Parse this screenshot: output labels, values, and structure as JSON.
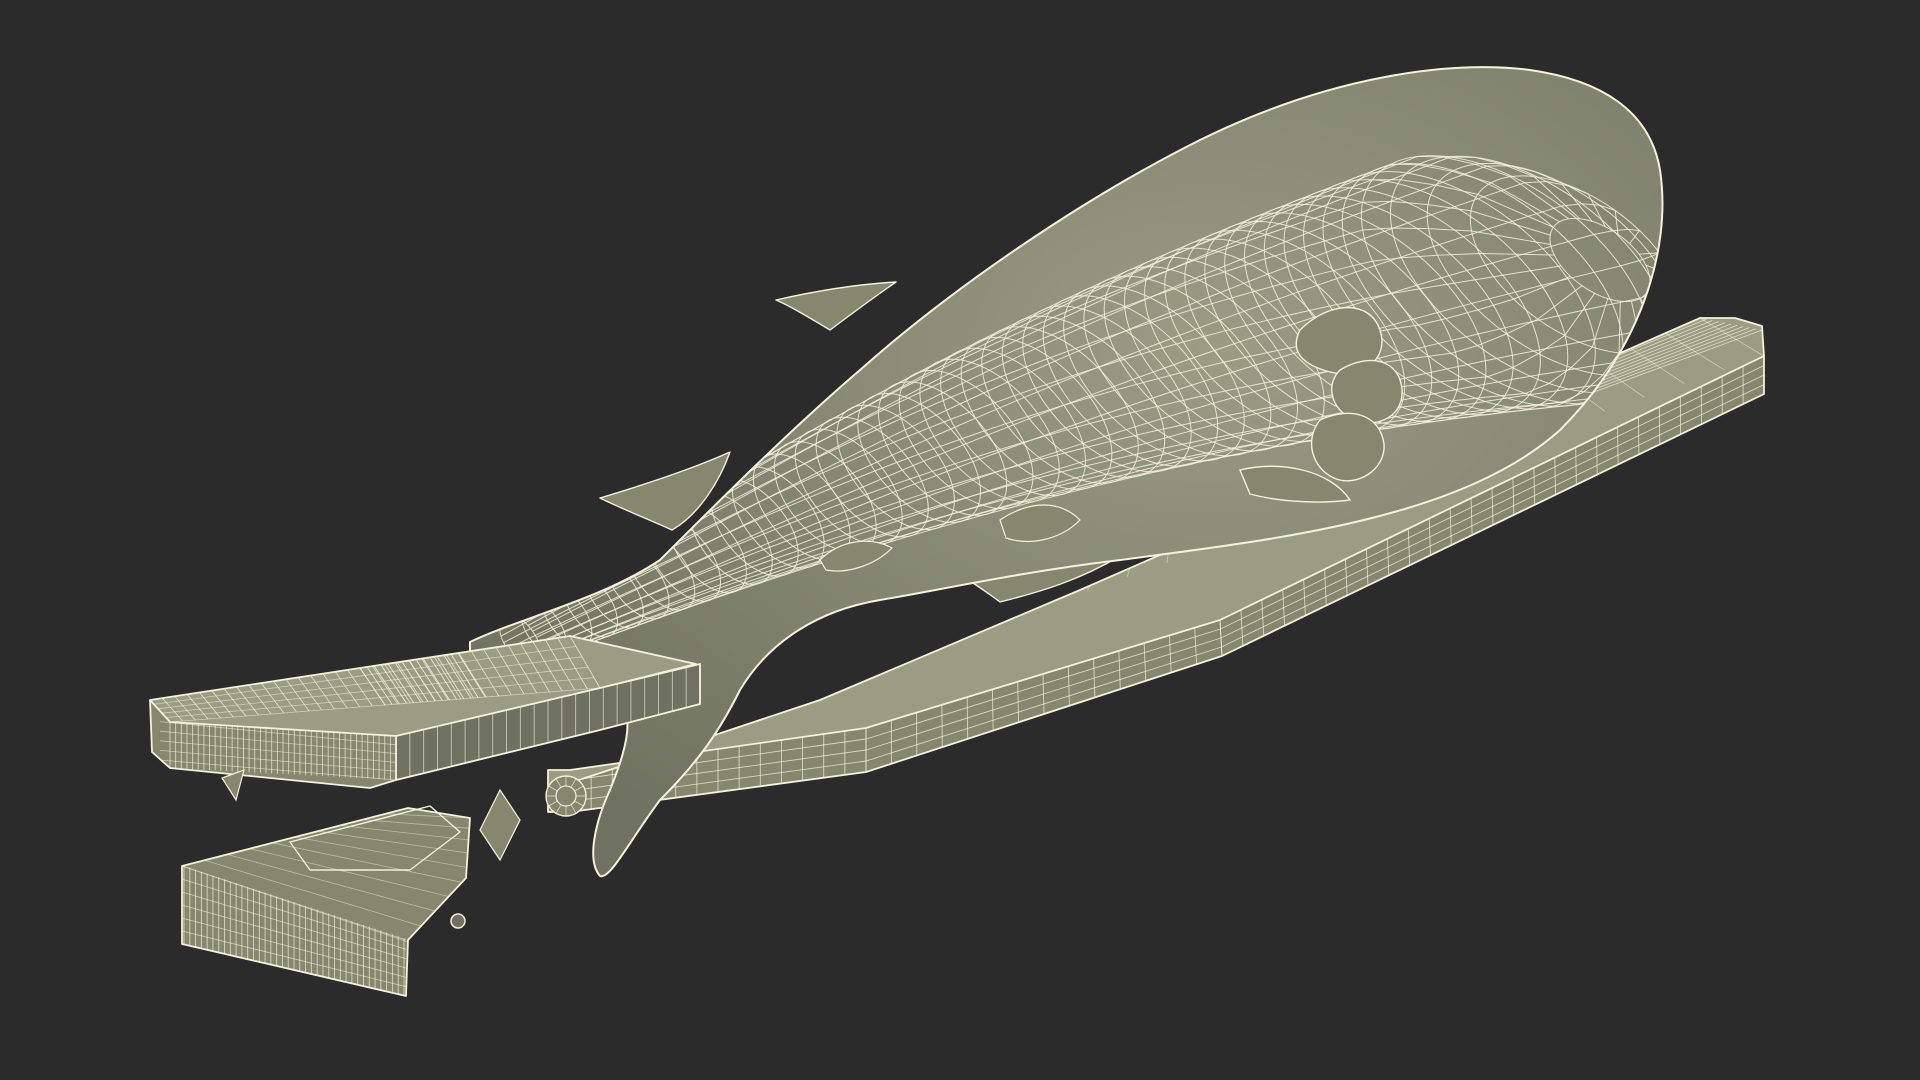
{
  "scene": {
    "background_color": "#2b2b2b",
    "mesh_fill_color": "#85876f",
    "mesh_fill_shadow_color": "#6f7260",
    "mesh_fill_light_color": "#9a9c84",
    "wire_color": "#f4f1dc",
    "objects": [
      {
        "name": "ham-leg"
      },
      {
        "name": "ham-holder-board"
      },
      {
        "name": "ham-clamp"
      }
    ]
  }
}
